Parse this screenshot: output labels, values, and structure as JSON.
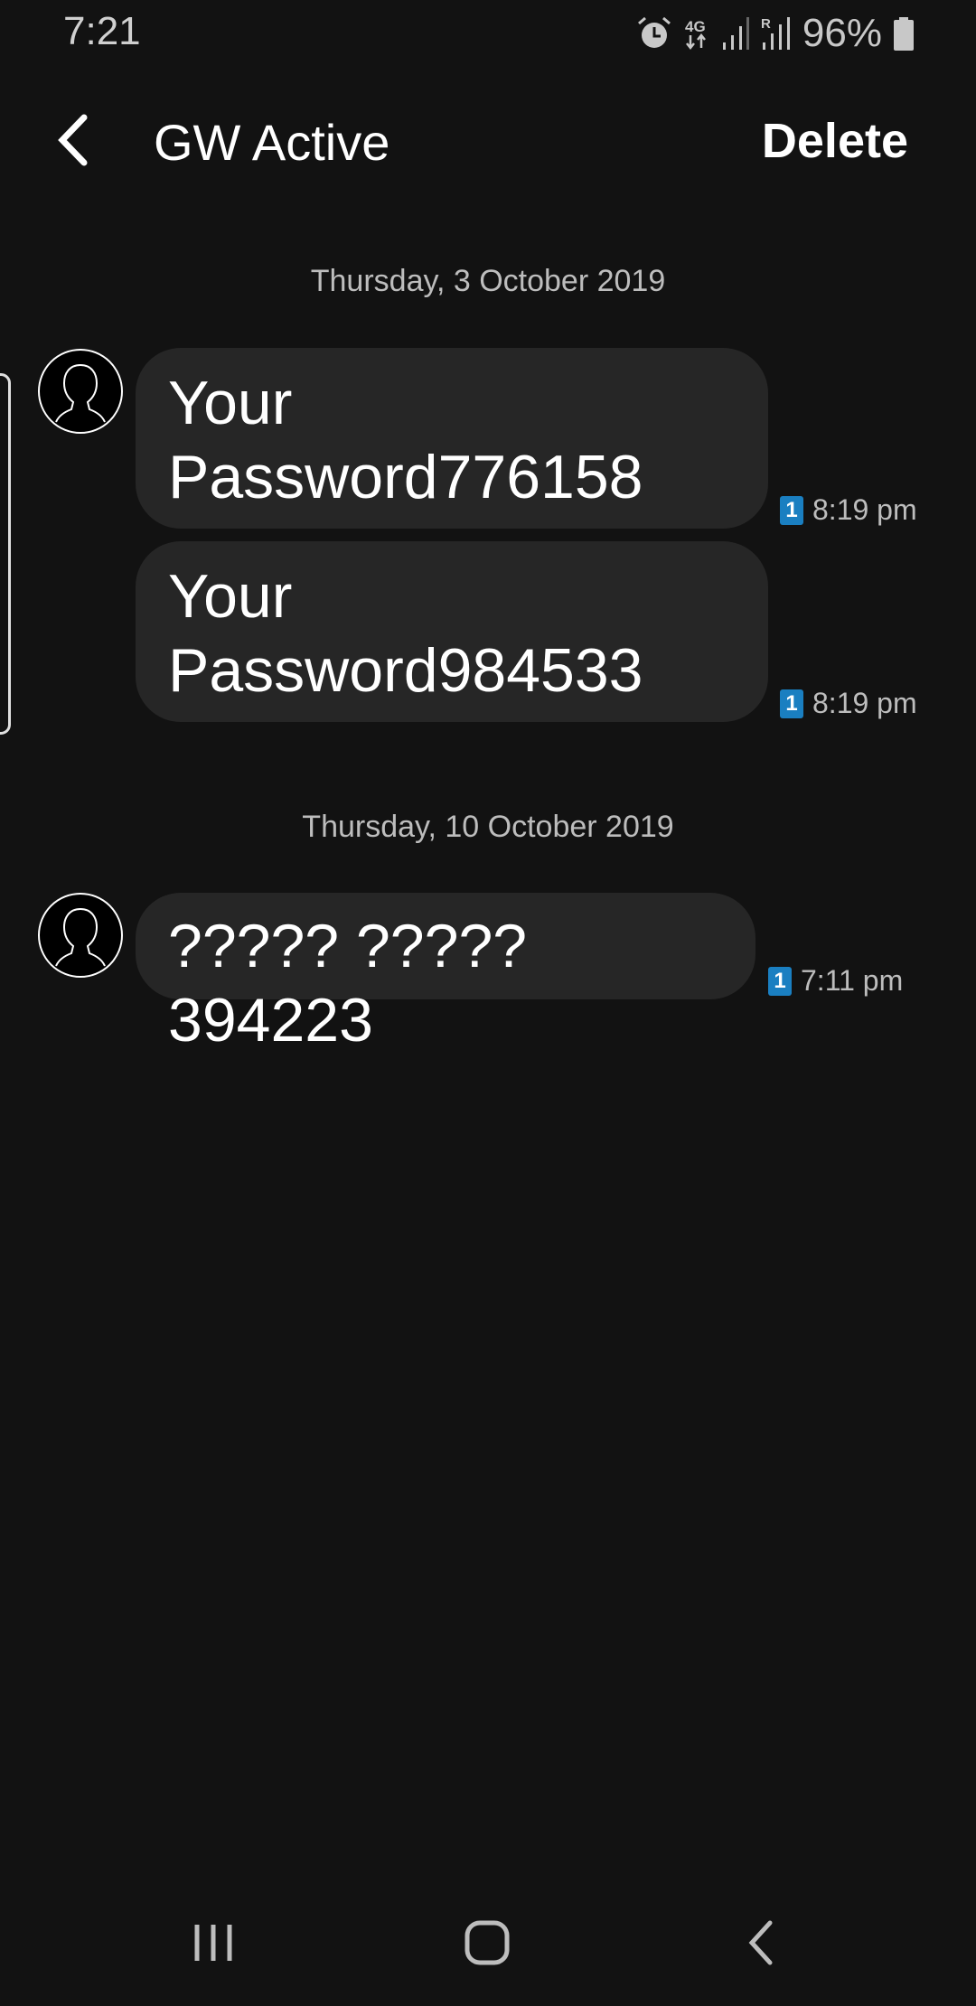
{
  "status_bar": {
    "time": "7:21",
    "battery": "96%",
    "icons": [
      "alarm-icon",
      "4g-data-icon",
      "signal-icon",
      "roaming-signal-icon",
      "battery-icon"
    ]
  },
  "header": {
    "title": "GW Active",
    "delete_label": "Delete",
    "back_icon": "chevron-left-icon"
  },
  "conversation": [
    {
      "date": "Thursday, 3 October 2019",
      "messages": [
        {
          "text": "Your Password776158",
          "sim": "1",
          "time": "8:19 pm"
        },
        {
          "text": "Your Password984533",
          "sim": "1",
          "time": "8:19 pm"
        }
      ]
    },
    {
      "date": "Thursday, 10 October 2019",
      "messages": [
        {
          "text": "????? ????? 394223",
          "sim": "1",
          "time": "7:11 pm"
        }
      ]
    }
  ],
  "colors": {
    "background": "#121212",
    "bubble": "#262626",
    "sim_badge": "#1a7fc1"
  },
  "nav_bar": {
    "icons": [
      "recents-icon",
      "home-icon",
      "back-icon"
    ]
  }
}
